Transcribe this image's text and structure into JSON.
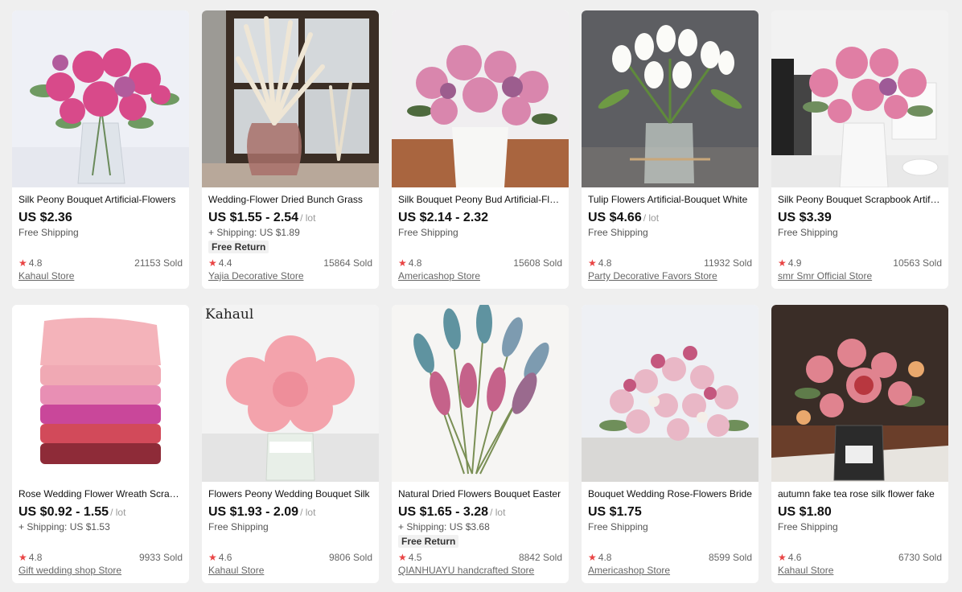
{
  "products": [
    {
      "title": "Silk Peony Bouquet Artificial-Flowers",
      "price": "US $2.36",
      "unit": "",
      "shipping": "Free Shipping",
      "badge": "",
      "rating": "4.8",
      "sold": "21153 Sold",
      "store": "Kahaul Store",
      "overlay": ""
    },
    {
      "title": "Wedding-Flower Dried Bunch Grass",
      "price": "US $1.55 - 2.54",
      "unit": "/ lot",
      "shipping": "+ Shipping: US $1.89",
      "badge": "Free Return",
      "rating": "4.4",
      "sold": "15864 Sold",
      "store": "Yajia Decorative Store",
      "overlay": ""
    },
    {
      "title": "Silk Bouquet Peony Bud Artificial-Flowers",
      "price": "US $2.14 - 2.32",
      "unit": "",
      "shipping": "Free Shipping",
      "badge": "",
      "rating": "4.8",
      "sold": "15608 Sold",
      "store": "Americashop Store",
      "overlay": ""
    },
    {
      "title": "Tulip Flowers Artificial-Bouquet White",
      "price": "US $4.66",
      "unit": "/ lot",
      "shipping": "Free Shipping",
      "badge": "",
      "rating": "4.8",
      "sold": "11932 Sold",
      "store": "Party Decorative Favors Store",
      "overlay": ""
    },
    {
      "title": "Silk Peony Bouquet Scrapbook Artificial",
      "price": "US $3.39",
      "unit": "",
      "shipping": "Free Shipping",
      "badge": "",
      "rating": "4.9",
      "sold": "10563 Sold",
      "store": "smr Smr Official Store",
      "overlay": ""
    },
    {
      "title": "Rose Wedding Flower Wreath Scrapbook",
      "price": "US $0.92 - 1.55",
      "unit": "/ lot",
      "shipping": "+ Shipping: US $1.53",
      "badge": "",
      "rating": "4.8",
      "sold": "9933 Sold",
      "store": "Gift wedding shop Store",
      "overlay": ""
    },
    {
      "title": "Flowers Peony Wedding Bouquet Silk",
      "price": "US $1.93 - 2.09",
      "unit": "/ lot",
      "shipping": "Free Shipping",
      "badge": "",
      "rating": "4.6",
      "sold": "9806 Sold",
      "store": "Kahaul Store",
      "overlay": "Kahaul"
    },
    {
      "title": "Natural Dried Flowers Bouquet Easter",
      "price": "US $1.65 - 3.28",
      "unit": "/ lot",
      "shipping": "+ Shipping: US $3.68",
      "badge": "Free Return",
      "rating": "4.5",
      "sold": "8842 Sold",
      "store": "QIANHUAYU handcrafted Store",
      "overlay": ""
    },
    {
      "title": "Bouquet Wedding Rose-Flowers Bride",
      "price": "US $1.75",
      "unit": "",
      "shipping": "Free Shipping",
      "badge": "",
      "rating": "4.8",
      "sold": "8599 Sold",
      "store": "Americashop Store",
      "overlay": ""
    },
    {
      "title": "autumn fake tea rose silk flower fake",
      "price": "US $1.80",
      "unit": "",
      "shipping": "Free Shipping",
      "badge": "",
      "rating": "4.6",
      "sold": "6730 Sold",
      "store": "Kahaul Store",
      "overlay": ""
    }
  ],
  "colors": {
    "background": "#efefef",
    "card": "#ffffff",
    "star": "#e94444",
    "price": "#111111",
    "muted": "#666666"
  },
  "icons": {
    "rating": "star-icon"
  }
}
